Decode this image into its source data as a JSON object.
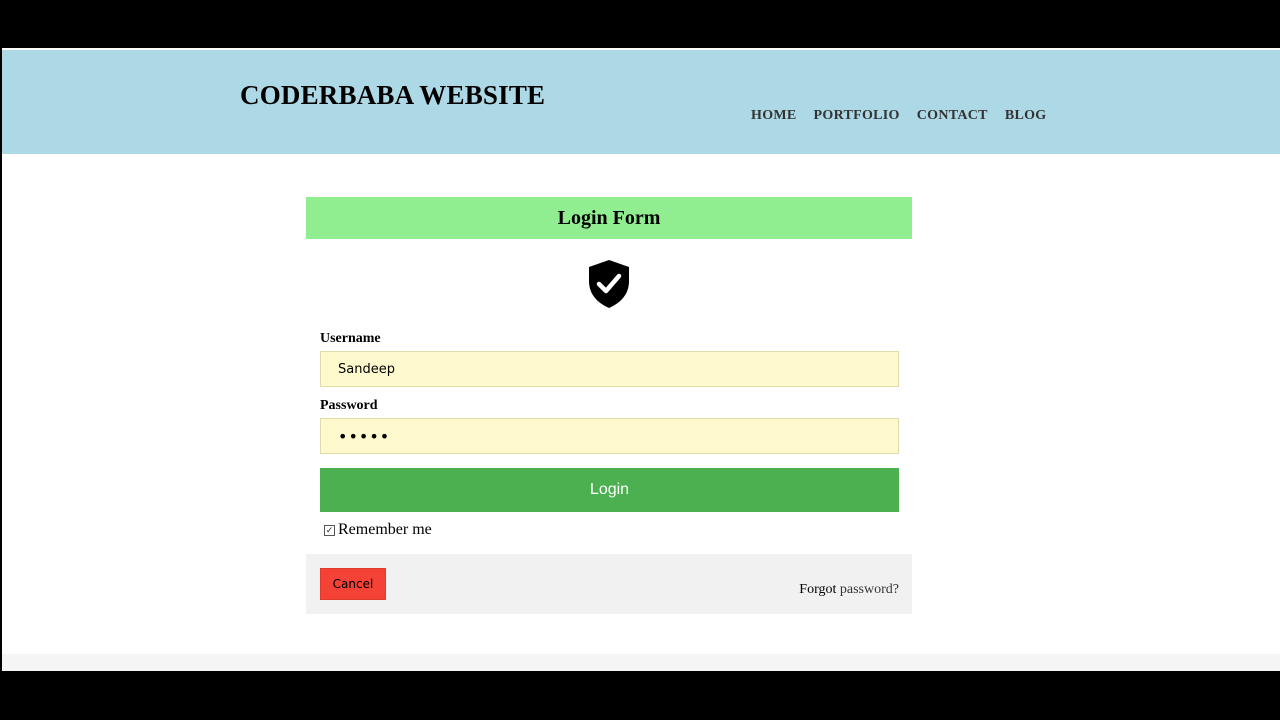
{
  "header": {
    "site_title": "CODERBABA WEBSITE",
    "nav": [
      "HOME",
      "PORTFOLIO",
      "CONTACT",
      "BLOG"
    ],
    "background": "#add8e6"
  },
  "form": {
    "title": "Login Form",
    "title_background": "#90ee90",
    "icon": "shield-check-icon",
    "username_label": "Username",
    "username_value": "Sandeep",
    "password_label": "Password",
    "password_value": "•••••",
    "login_label": "Login",
    "login_color": "#4caf50",
    "remember_label": "Remember me",
    "remember_checked": true,
    "cancel_label": "Cancel",
    "cancel_color": "#f44336",
    "forgot_prefix": "Forgot ",
    "forgot_link": "password?"
  }
}
